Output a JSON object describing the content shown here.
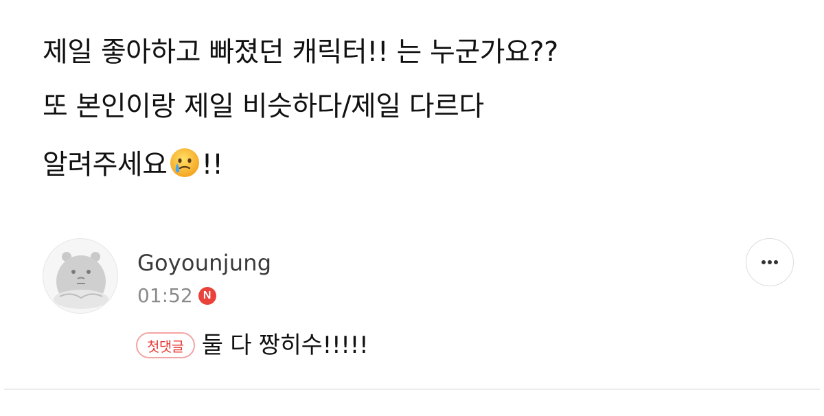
{
  "post": {
    "line1": "제일 좋아하고 빠졌던 캐릭터!! 는 누군가요??",
    "line2": "또 본인이랑 제일 비슷하다/제일 다르다",
    "line3_text": "알려주세요",
    "line3_emoji_icon": "face-holding-back-tears-icon",
    "line3_suffix": "!!"
  },
  "comment": {
    "author": "Goyounjung",
    "time": "01:52",
    "new_badge": "N",
    "first_comment_badge": "첫댓글",
    "text": "둘 다 짱히수!!!!!",
    "more_icon": "more-dots-icon"
  },
  "colors": {
    "text": "#111111",
    "meta": "#8a8a8a",
    "new_badge_bg": "#e8423a",
    "first_badge_border": "#f4a3a3",
    "first_badge_text": "#e53935",
    "divider": "#ececec"
  }
}
